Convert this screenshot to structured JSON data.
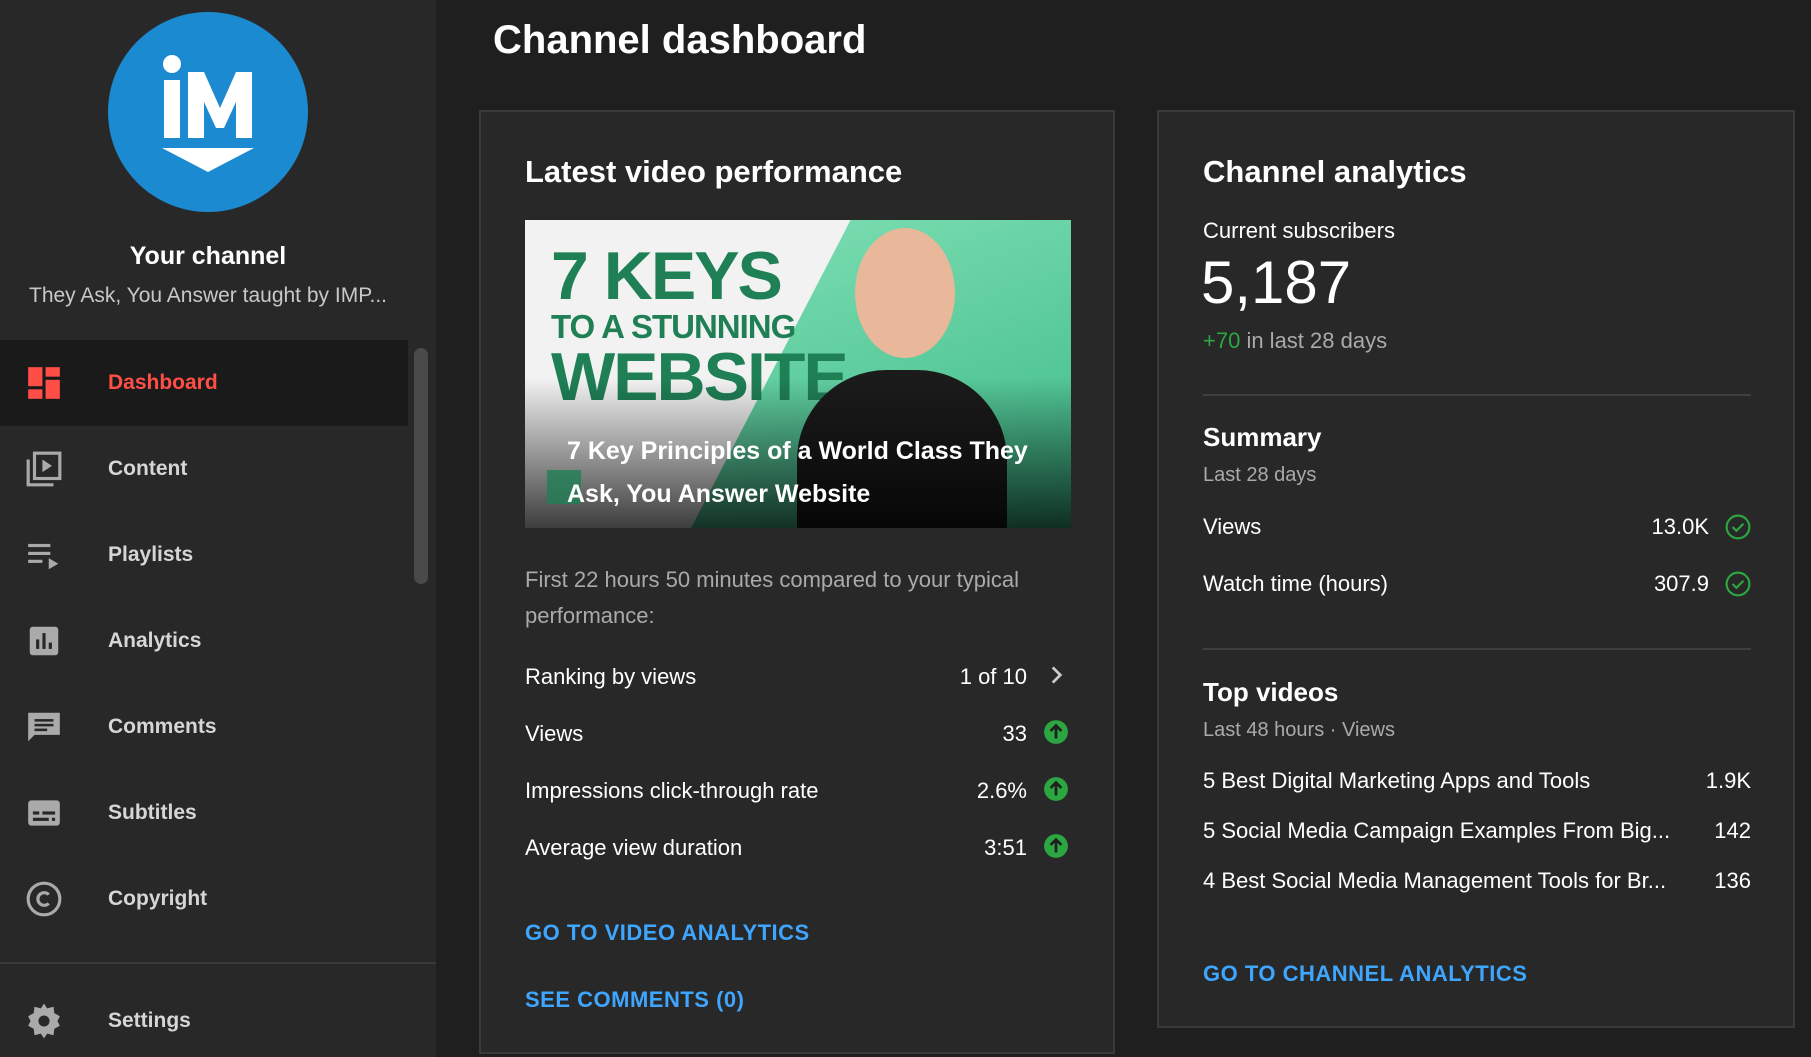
{
  "sidebar": {
    "channel_title": "Your channel",
    "channel_subtitle": "They Ask, You Answer taught by IMP...",
    "items": [
      {
        "label": "Dashboard",
        "icon": "dashboard-icon",
        "active": true
      },
      {
        "label": "Content",
        "icon": "content-icon"
      },
      {
        "label": "Playlists",
        "icon": "playlists-icon"
      },
      {
        "label": "Analytics",
        "icon": "analytics-icon"
      },
      {
        "label": "Comments",
        "icon": "comments-icon"
      },
      {
        "label": "Subtitles",
        "icon": "subtitles-icon"
      },
      {
        "label": "Copyright",
        "icon": "copyright-icon"
      }
    ],
    "settings_label": "Settings"
  },
  "page_title": "Channel dashboard",
  "latest_video": {
    "title": "Latest video performance",
    "thumbnail": {
      "line1": "7 KEYS",
      "line2": "TO A STUNNING",
      "line3": "WEBSITE",
      "caption": "7 Key Principles of a World Class They Ask, You Answer Website"
    },
    "note": "First 22 hours 50 minutes compared to your typical performance:",
    "metrics": [
      {
        "label": "Ranking by views",
        "value": "1 of 10",
        "indicator": "chevron-right-icon"
      },
      {
        "label": "Views",
        "value": "33",
        "indicator": "arrow-up-icon"
      },
      {
        "label": "Impressions click-through rate",
        "value": "2.6%",
        "indicator": "arrow-up-icon"
      },
      {
        "label": "Average view duration",
        "value": "3:51",
        "indicator": "arrow-up-icon"
      }
    ],
    "link_analytics": "GO TO VIDEO ANALYTICS",
    "link_comments": "SEE COMMENTS (0)"
  },
  "channel_analytics": {
    "title": "Channel analytics",
    "subscribers_label": "Current subscribers",
    "subscribers": "5,187",
    "change_value": "+70",
    "change_text": " in last 28 days",
    "summary_title": "Summary",
    "summary_period": "Last 28 days",
    "summary": [
      {
        "label": "Views",
        "value": "13.0K"
      },
      {
        "label": "Watch time (hours)",
        "value": "307.9"
      }
    ],
    "top_title": "Top videos",
    "top_period": "Last 48 hours · Views",
    "top_videos": [
      {
        "title": "5 Best Digital Marketing Apps and Tools",
        "views": "1.9K"
      },
      {
        "title": "5 Social Media Campaign Examples From Big...",
        "views": "142"
      },
      {
        "title": "4 Best Social Media Management Tools for Br...",
        "views": "136"
      }
    ],
    "link": "GO TO CHANNEL ANALYTICS"
  },
  "colors": {
    "accent_red": "#ff4e45",
    "link_blue": "#3ea6ff",
    "positive_green": "#2ba640",
    "avatar_blue": "#1c8ad1"
  }
}
